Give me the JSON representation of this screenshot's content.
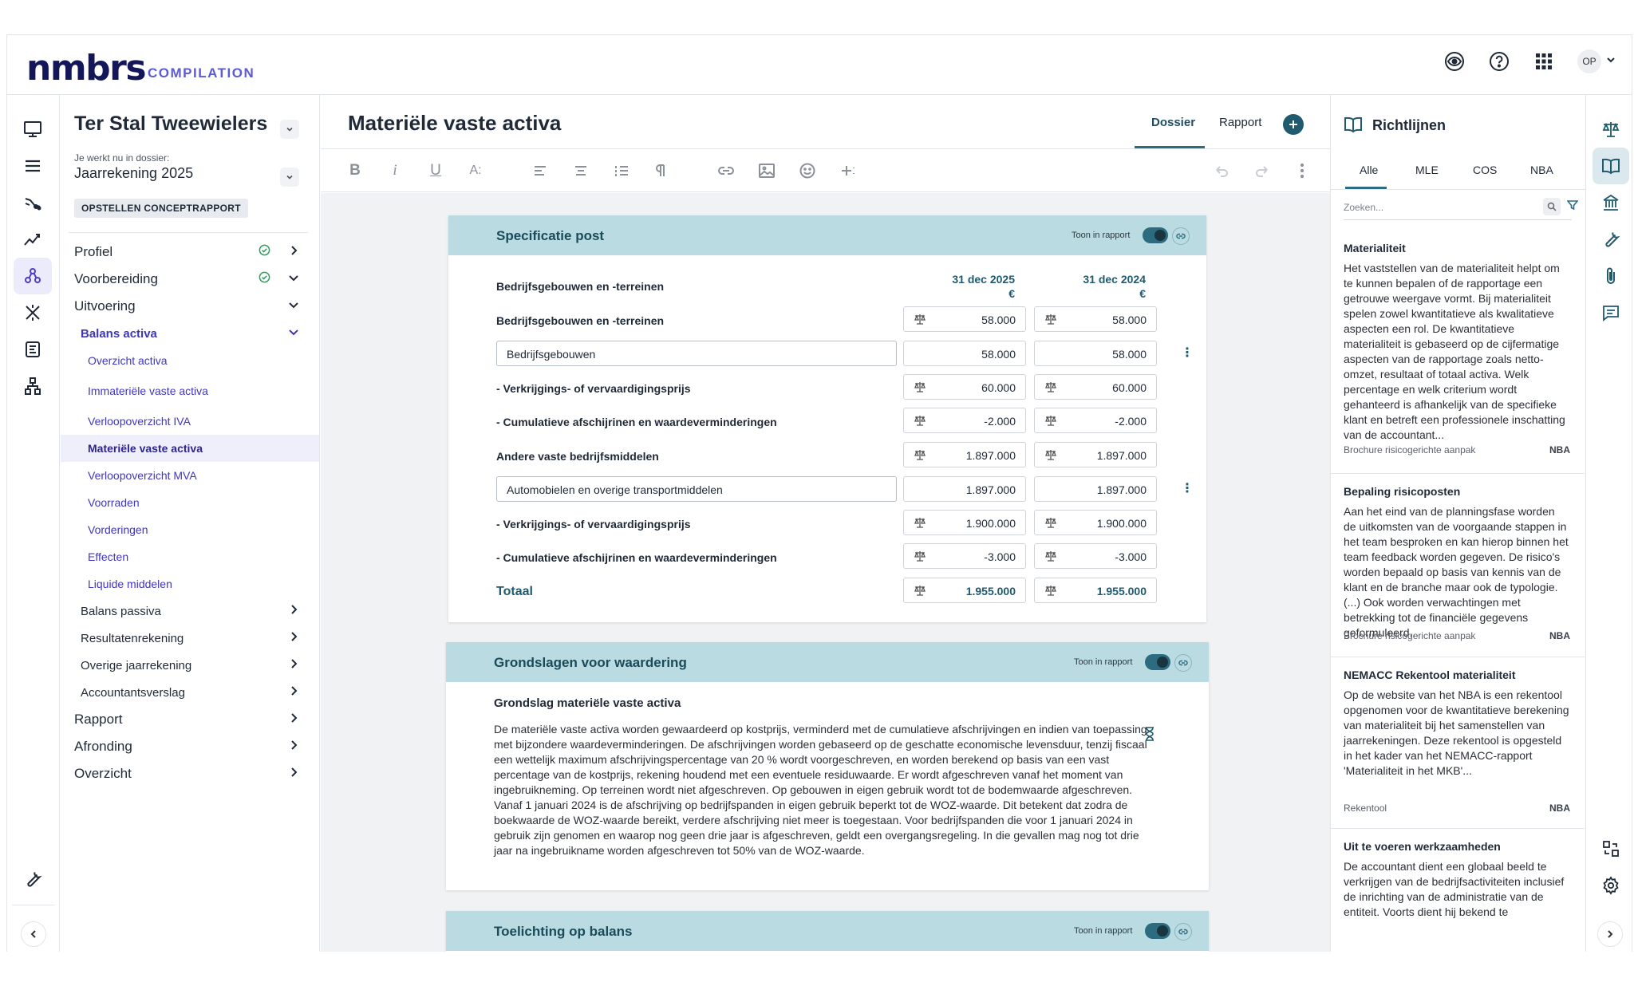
{
  "brand": {
    "name": "nmbrs",
    "product": "COMPILATION"
  },
  "header": {
    "avatar": "OP",
    "icons": [
      "eye-icon",
      "help-icon",
      "apps-grid-icon",
      "chevron-down-icon"
    ]
  },
  "nav": {
    "client": "Ter Stal Tweewielers",
    "dossier_label": "Je werkt nu in dossier:",
    "dossier_value": "Jaarrekening 2025",
    "status": "OPSTELLEN CONCEPTRAPPORT",
    "items": [
      {
        "label": "Profiel"
      },
      {
        "label": "Voorbereiding"
      },
      {
        "label": "Uitvoering"
      },
      {
        "label": "Balans activa"
      },
      {
        "label": "Overzicht activa"
      },
      {
        "label": "Immateriële vaste activa"
      },
      {
        "label": "Verloopoverzicht IVA"
      },
      {
        "label": "Materiële vaste activa"
      },
      {
        "label": "Verloopoverzicht MVA"
      },
      {
        "label": "Voorraden"
      },
      {
        "label": "Vorderingen"
      },
      {
        "label": "Effecten"
      },
      {
        "label": "Liquide middelen"
      },
      {
        "label": "Balans passiva"
      },
      {
        "label": "Resultatenrekening"
      },
      {
        "label": "Overige jaarrekening"
      },
      {
        "label": "Accountantsverslag"
      },
      {
        "label": "Rapport"
      },
      {
        "label": "Afronding"
      },
      {
        "label": "Overzicht"
      }
    ]
  },
  "main": {
    "title": "Materiële vaste activa",
    "tabs": [
      "Dossier",
      "Rapport"
    ],
    "toolbar": [
      "B",
      "i",
      "U",
      "A:"
    ],
    "spec": {
      "title": "Specificatie post",
      "toon_label": "Toon in rapport",
      "group_label": "Bedrijfsgebouwen en -terreinen",
      "col1": "31 dec 2025",
      "col2": "31 dec 2024",
      "currency": "€",
      "rows": [
        {
          "label": "Bedrijfsgebouwen en -terreinen",
          "v1": "58.000",
          "v2": "58.000"
        },
        {
          "label": "Bedrijfsgebouwen",
          "v1": "58.000",
          "v2": "58.000"
        },
        {
          "label": "- Verkrijgings- of vervaardigingsprijs",
          "v1": "60.000",
          "v2": "60.000"
        },
        {
          "label": "- Cumulatieve afschijrinen en waardeverminderingen",
          "v1": "-2.000",
          "v2": "-2.000"
        },
        {
          "label": "Andere vaste bedrijfsmiddelen",
          "v1": "1.897.000",
          "v2": "1.897.000"
        },
        {
          "label": "Automobielen en overige transportmiddelen",
          "v1": "1.897.000",
          "v2": "1.897.000"
        },
        {
          "label": "- Verkrijgings- of vervaardigingsprijs",
          "v1": "1.900.000",
          "v2": "1.900.000"
        },
        {
          "label": "- Cumulatieve afschijrinen en waardeverminderingen",
          "v1": "-3.000",
          "v2": "-3.000"
        },
        {
          "label": "Totaal",
          "v1": "1.955.000",
          "v2": "1.955.000"
        }
      ]
    },
    "grondslagen": {
      "title": "Grondslagen voor waardering",
      "toon_label": "Toon in rapport",
      "subtitle": "Grondslag materiële vaste activa",
      "text": "De materiële vaste activa worden gewaardeerd op kostprijs, verminderd met de cumulatieve afschrijvingen en indien van toepassing met bijzondere waardeverminderingen. De afschrijvingen worden gebaseerd op de geschatte economische levensduur, tenzij fiscaal een wettelijk maximum afschrijvingspercentage van 20 % wordt voorgeschreven, en worden berekend op basis van een vast percentage van de kostprijs, rekening houdend met een eventuele residuwaarde. Er wordt afgeschreven vanaf het moment van ingebruikneming. Op terreinen wordt niet afgeschreven. Op gebouwen in eigen gebruik wordt tot de bodemwaarde afgeschreven.",
      "text2": "Vanaf 1 januari 2024 is de afschrijving op bedrijfspanden in eigen gebruik beperkt tot de WOZ-waarde. Dit betekent dat zodra de boekwaarde de WOZ-waarde bereikt, verdere afschrijving niet meer is toegestaan. Voor bedrijfspanden die voor 1 januari 2024 in gebruik zijn genomen en waarop nog geen drie jaar is afgeschreven, geldt een overgangsregeling. In die gevallen mag nog tot drie jaar na ingebruikname worden afgeschreven tot 50% van de WOZ-waarde."
    },
    "toelichting": {
      "title": "Toelichting op balans",
      "toon_label": "Toon in rapport"
    }
  },
  "panel": {
    "title": "Richtlijnen",
    "tabs": [
      "Alle",
      "MLE",
      "COS",
      "NBA"
    ],
    "search_placeholder": "Zoeken...",
    "items": [
      {
        "title": "Materialiteit",
        "body": "Het vaststellen van de materialiteit helpt om te kunnen bepalen of de rapportage een getrouwe weergave vormt. Bij materialiteit spelen zowel kwantitatieve als kwalitatieve aspecten een rol. De kwantitatieve materialiteit is gebaseerd op de cijfermatige aspecten van de rapportage zoals netto-omzet, resultaat of totaal activa. Welk percentage en welk criterium wordt gehanteerd is afhankelijk van de specifieke klant en betreft een professionele inschatting van de accountant...",
        "source": "Brochure risicogerichte aanpak",
        "tag": "NBA"
      },
      {
        "title": "Bepaling risicoposten",
        "body": "Aan het eind van de planningsfase worden de uitkomsten van de voorgaande stappen in het team besproken en kan hierop binnen het team feedback worden gegeven. De risico's worden bepaald op basis van kennis van de klant en de branche maar ook de typologie. (...) Ook worden verwachtingen met betrekking tot de financiële gegevens geformuleerd...",
        "source": "Brochure risicogerichte aanpak",
        "tag": "NBA"
      },
      {
        "title": "NEMACC Rekentool materialiteit",
        "body": "Op de website van het NBA is een rekentool opgenomen voor de kwantitatieve berekening van materialiteit bij het samenstellen van jaarrekeningen. Deze rekentool is opgesteld in het kader van het NEMACC-rapport 'Materialiteit in het MKB'...",
        "source": "Rekentool",
        "tag": "NBA"
      },
      {
        "title": "Uit te voeren werkzaamheden",
        "body": "De accountant dient een globaal beeld te verkrijgen van de bedrijfsactiviteiten inclusief de inrichting van de administratie van de entiteit. Voorts dient hij bekend te",
        "source": "",
        "tag": ""
      }
    ]
  }
}
